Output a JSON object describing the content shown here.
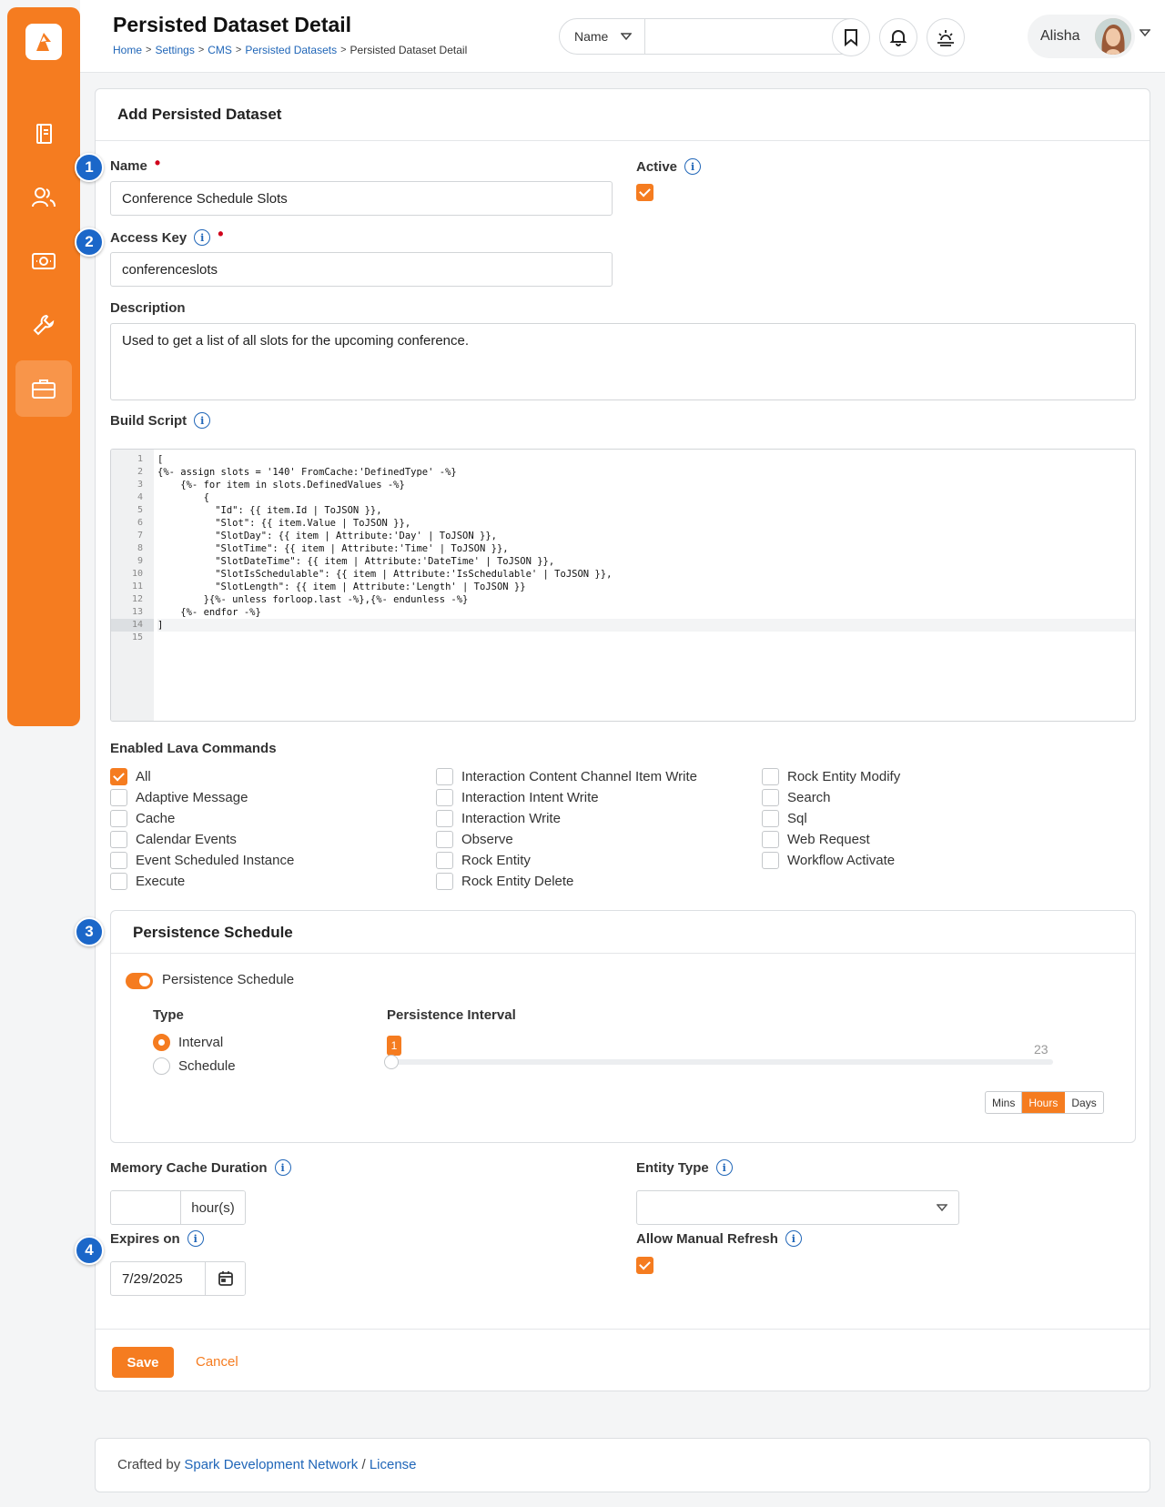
{
  "header": {
    "title": "Persisted Dataset Detail",
    "breadcrumb": [
      "Home",
      "Settings",
      "CMS",
      "Persisted Datasets",
      "Persisted Dataset Detail"
    ],
    "search_type": "Name",
    "search_placeholder": "",
    "user_name": "Alisha"
  },
  "sidebar": {
    "items": [
      {
        "name": "book-icon"
      },
      {
        "name": "people-icon"
      },
      {
        "name": "money-icon"
      },
      {
        "name": "wrench-icon"
      },
      {
        "name": "briefcase-icon",
        "active": true
      }
    ]
  },
  "card": {
    "title": "Add Persisted Dataset",
    "name_label": "Name",
    "name_value": "Conference Schedule Slots",
    "active_label": "Active",
    "active_checked": true,
    "access_key_label": "Access Key",
    "access_key_value": "conferenceslots",
    "description_label": "Description",
    "description_value": "Used to get a list of all slots for the upcoming conference.",
    "build_script_label": "Build Script",
    "build_script_lines": [
      "[",
      "{%- assign slots = '140' FromCache:'DefinedType' -%}",
      "    {%- for item in slots.DefinedValues -%}",
      "        {",
      "          \"Id\": {{ item.Id | ToJSON }},",
      "          \"Slot\": {{ item.Value | ToJSON }},",
      "          \"SlotDay\": {{ item | Attribute:'Day' | ToJSON }},",
      "          \"SlotTime\": {{ item | Attribute:'Time' | ToJSON }},",
      "          \"SlotDateTime\": {{ item | Attribute:'DateTime' | ToJSON }},",
      "          \"SlotIsSchedulable\": {{ item | Attribute:'IsSchedulable' | ToJSON }},",
      "          \"SlotLength\": {{ item | Attribute:'Length' | ToJSON }}",
      "        }{%- unless forloop.last -%},{%- endunless -%}",
      "    {%- endfor -%}",
      "]",
      ""
    ],
    "lava_label": "Enabled Lava Commands",
    "lava_commands": [
      {
        "label": "All",
        "checked": true
      },
      {
        "label": "Adaptive Message",
        "checked": false
      },
      {
        "label": "Cache",
        "checked": false
      },
      {
        "label": "Calendar Events",
        "checked": false
      },
      {
        "label": "Event Scheduled Instance",
        "checked": false
      },
      {
        "label": "Execute",
        "checked": false
      },
      {
        "label": "Interaction Content Channel Item Write",
        "checked": false
      },
      {
        "label": "Interaction Intent Write",
        "checked": false
      },
      {
        "label": "Interaction Write",
        "checked": false
      },
      {
        "label": "Observe",
        "checked": false
      },
      {
        "label": "Rock Entity",
        "checked": false
      },
      {
        "label": "Rock Entity Delete",
        "checked": false
      },
      {
        "label": "Rock Entity Modify",
        "checked": false
      },
      {
        "label": "Search",
        "checked": false
      },
      {
        "label": "Sql",
        "checked": false
      },
      {
        "label": "Web Request",
        "checked": false
      },
      {
        "label": "Workflow Activate",
        "checked": false
      }
    ],
    "persistence": {
      "title": "Persistence Schedule",
      "toggle_label": "Persistence Schedule",
      "toggle_on": true,
      "type_label": "Type",
      "type_options": [
        "Interval",
        "Schedule"
      ],
      "type_selected": "Interval",
      "interval_label": "Persistence Interval",
      "interval_value": "1",
      "interval_max": "23",
      "units": [
        "Mins",
        "Hours",
        "Days"
      ],
      "unit_selected": "Hours"
    },
    "memory_cache_label": "Memory Cache Duration",
    "memory_cache_value": "",
    "memory_cache_unit": "hour(s)",
    "entity_type_label": "Entity Type",
    "entity_type_value": "",
    "expires_label": "Expires on",
    "expires_value": "7/29/2025",
    "manual_refresh_label": "Allow Manual Refresh",
    "manual_refresh_checked": true,
    "save_label": "Save",
    "cancel_label": "Cancel"
  },
  "badges": [
    "1",
    "2",
    "3",
    "4"
  ],
  "footer": {
    "crafted_by": "Crafted by",
    "link1": "Spark Development Network",
    "separator": "/",
    "link2": "License"
  },
  "colors": {
    "accent": "#f57c20",
    "link": "#2066b8",
    "badge": "#1b67c9"
  }
}
